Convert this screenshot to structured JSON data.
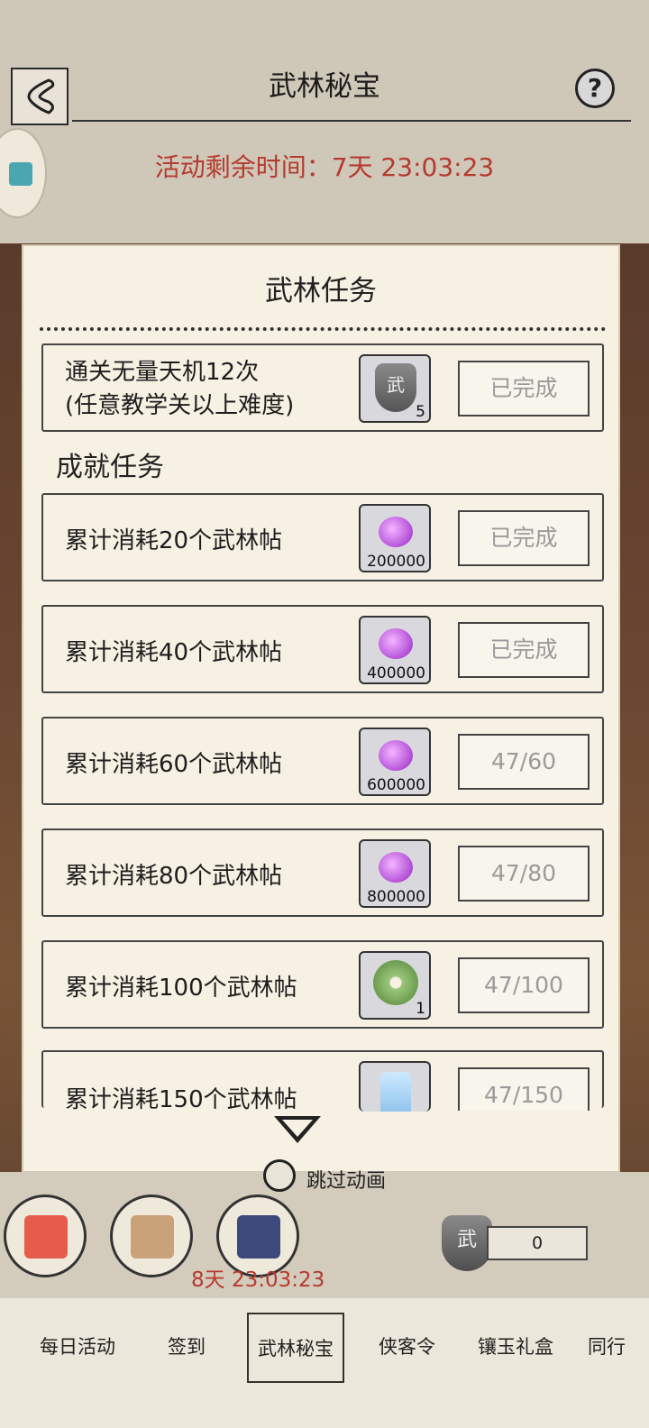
{
  "header": {
    "title": "武林秘宝",
    "timer": "活动剩余时间：7天 23:03:23",
    "help_label": "?"
  },
  "panel": {
    "title": "武林任务",
    "main_task": {
      "text_line1": "通关无量天机12次",
      "text_line2": "(任意教学关以上难度)",
      "reward_icon": "wu-shield-icon",
      "reward_count": "5",
      "status": "已完成"
    },
    "achievement_title": "成就任务",
    "achievements": [
      {
        "text": "累计消耗20个武林帖",
        "reward_icon": "purple-gem-icon",
        "reward_count": "200000",
        "status": "已完成"
      },
      {
        "text": "累计消耗40个武林帖",
        "reward_icon": "purple-gem-icon",
        "reward_count": "400000",
        "status": "已完成"
      },
      {
        "text": "累计消耗60个武林帖",
        "reward_icon": "purple-gem-icon",
        "reward_count": "600000",
        "status": "47/60"
      },
      {
        "text": "累计消耗80个武林帖",
        "reward_icon": "purple-gem-icon",
        "reward_count": "800000",
        "status": "47/80"
      },
      {
        "text": "累计消耗100个武林帖",
        "reward_icon": "jade-coin-icon",
        "reward_count": "1",
        "status": "47/100"
      },
      {
        "text": "累计消耗150个武林帖",
        "reward_icon": "jade-token-icon",
        "reward_count": "",
        "status": "47/150"
      }
    ]
  },
  "bottom": {
    "skip_label": "跳过动画",
    "icon_timer": "8天 23:03:23",
    "token_icon_label": "武",
    "token_count": "0"
  },
  "tabs": [
    "每日活动",
    "签到",
    "武林秘宝",
    "侠客令",
    "镶玉礼盒",
    "同行"
  ],
  "active_tab": "武林秘宝",
  "colors": {
    "timer_red": "#b63a2f",
    "panel_bg": "#f6f1e3",
    "status_grey": "#9a9a9a"
  }
}
